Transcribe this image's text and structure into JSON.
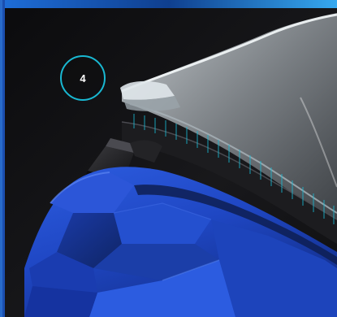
{
  "callout": {
    "number": "4"
  },
  "colors": {
    "accent": "#19b8d2",
    "background": "#0e0e10",
    "helmet_blue": "#1f47c4",
    "vent_black": "#1a1a1c"
  },
  "scene": {
    "subject_icon": "helmet-visor-icon"
  }
}
